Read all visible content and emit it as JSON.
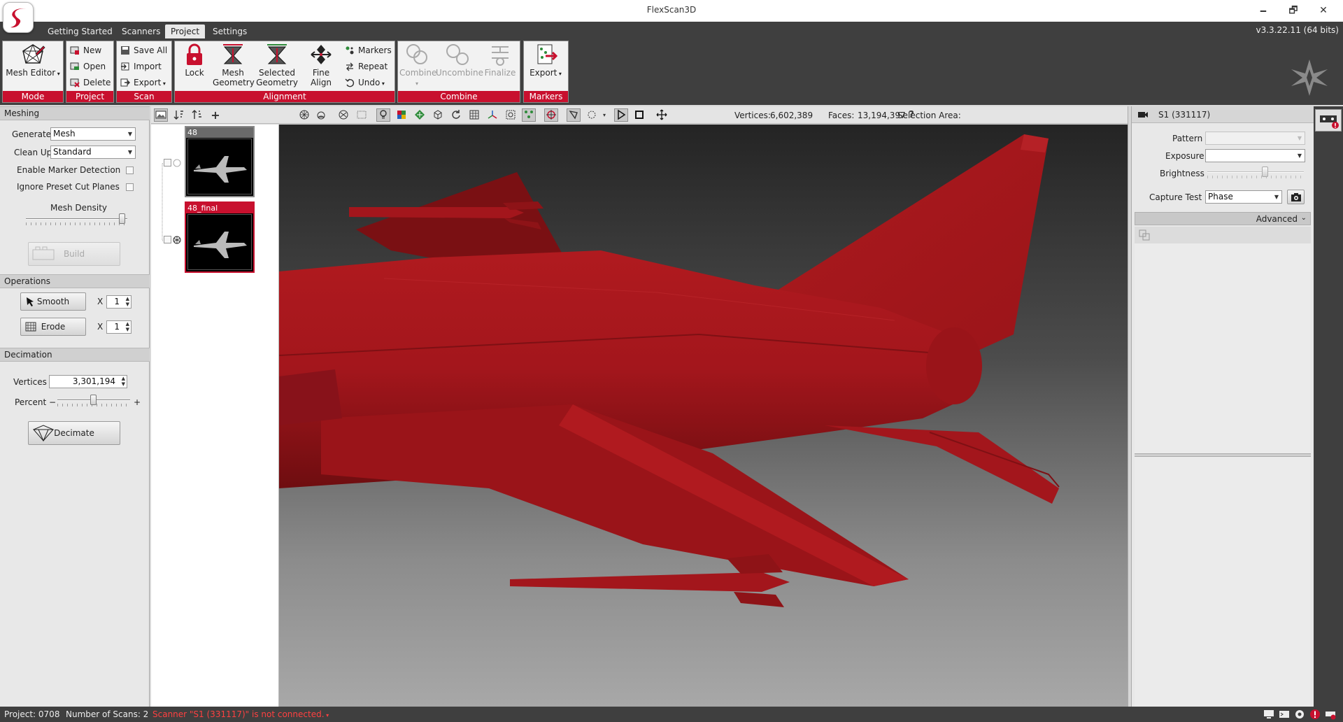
{
  "window": {
    "title": "FlexScan3D",
    "minimize": "🗕",
    "restore": "🗗",
    "close": "✕"
  },
  "tabs": [
    {
      "label": "Getting Started"
    },
    {
      "label": "Scanners"
    },
    {
      "label": "Project"
    },
    {
      "label": "Settings"
    }
  ],
  "version": "v3.3.22.11  (64 bits)",
  "ribbon": {
    "mode": {
      "label": "Mode",
      "mesh_editor": "Mesh Editor"
    },
    "project": {
      "label": "Project",
      "new": "New",
      "open": "Open",
      "delete": "Delete"
    },
    "scan": {
      "label": "Scan",
      "save_all": "Save All",
      "import": "Import",
      "export": "Export"
    },
    "alignment": {
      "label": "Alignment",
      "lock": "Lock",
      "mesh_geometry_1": "Mesh",
      "mesh_geometry_2": "Geometry",
      "selected_geometry_1": "Selected",
      "selected_geometry_2": "Geometry",
      "fine_align": "Fine Align",
      "markers": "Markers",
      "repeat": "Repeat",
      "undo": "Undo"
    },
    "combine": {
      "label": "Combine",
      "combine": "Combine",
      "uncombine": "Uncombine",
      "finalize": "Finalize"
    },
    "markers": {
      "label": "Markers",
      "export": "Export"
    }
  },
  "toolbar": {
    "vertices_label": "Vertices:",
    "vertices_value": "6,602,389",
    "faces_label": "Faces:",
    "faces_value": "13,194,397",
    "selection_label": "Selection Area:",
    "help": "?"
  },
  "meshing": {
    "header": "Meshing",
    "generate_label": "Generate",
    "generate_value": "Mesh",
    "cleanup_label": "Clean Up",
    "cleanup_value": "Standard",
    "marker_detection": "Enable Marker Detection",
    "ignore_cut_planes": "Ignore Preset Cut Planes",
    "density_label": "Mesh Density",
    "density": 0.95,
    "build": "Build"
  },
  "operations": {
    "header": "Operations",
    "smooth": "Smooth",
    "erode": "Erode",
    "x": "X",
    "smooth_count": "1",
    "erode_count": "1"
  },
  "decimation": {
    "header": "Decimation",
    "vertices_label": "Vertices",
    "vertices_value": "3,301,194",
    "percent_label": "Percent",
    "minus": "−",
    "plus": "+",
    "percent": 0.5,
    "decimate": "Decimate"
  },
  "scans": [
    {
      "name": "48"
    },
    {
      "name": "48_final"
    }
  ],
  "right": {
    "scanner_title": "S1 (331117)",
    "pattern_label": "Pattern",
    "exposure_label": "Exposure",
    "brightness_label": "Brightness",
    "brightness": 0.6,
    "capture_label": "Capture Test",
    "capture_value": "Phase",
    "advanced": "Advanced"
  },
  "status": {
    "project": "Project:  0708",
    "scans": "Number of Scans:  2",
    "message": "Scanner \"S1 (331117)\" is not connected."
  },
  "colors": {
    "accent": "#c8102e",
    "model": "#a3161c",
    "status_error": "#ff4040"
  }
}
